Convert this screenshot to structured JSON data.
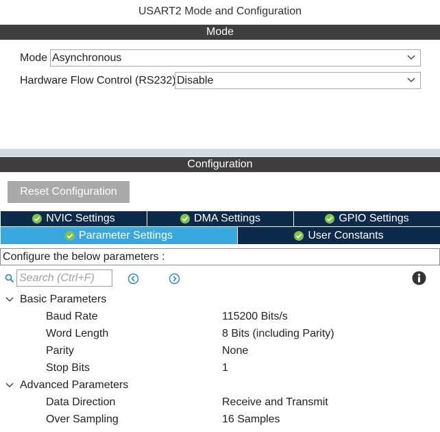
{
  "window": {
    "title": "USART2 Mode and Configuration"
  },
  "mode_section": {
    "header": "Mode",
    "mode_label": "Mode",
    "mode_value": "Asynchronous",
    "flow_label": "Hardware Flow Control (RS232)",
    "flow_value": "Disable"
  },
  "config_section": {
    "header": "Configuration",
    "reset_label": "Reset Configuration",
    "tabs_row1": [
      {
        "label": "NVIC Settings",
        "icon": "check-circle-icon"
      },
      {
        "label": "DMA Settings",
        "icon": "check-circle-icon"
      },
      {
        "label": "GPIO Settings",
        "icon": "check-circle-icon"
      }
    ],
    "tabs_row2": [
      {
        "label": "Parameter Settings",
        "icon": "check-circle-icon",
        "active": true
      },
      {
        "label": "User Constants",
        "icon": "check-circle-icon",
        "active": false
      }
    ],
    "configure_text": "Configure the below parameters :",
    "search_placeholder": "Search (Ctrl+F)"
  },
  "parameters": {
    "groups": [
      {
        "name": "Basic Parameters",
        "rows": [
          {
            "name": "Baud Rate",
            "value": "115200 Bits/s"
          },
          {
            "name": "Word Length",
            "value": "8 Bits (including Parity)"
          },
          {
            "name": "Parity",
            "value": "None"
          },
          {
            "name": "Stop Bits",
            "value": "1"
          }
        ]
      },
      {
        "name": "Advanced Parameters",
        "rows": [
          {
            "name": "Data Direction",
            "value": "Receive and Transmit"
          },
          {
            "name": "Over Sampling",
            "value": "16 Samples"
          }
        ]
      }
    ]
  },
  "colors": {
    "header_bar": "#3f3f3f",
    "tab_dark": "#0d2a4a",
    "tab_active": "#3aa7dd",
    "accent_blue": "#2a8ad4",
    "check_green": "#7fc34a"
  }
}
